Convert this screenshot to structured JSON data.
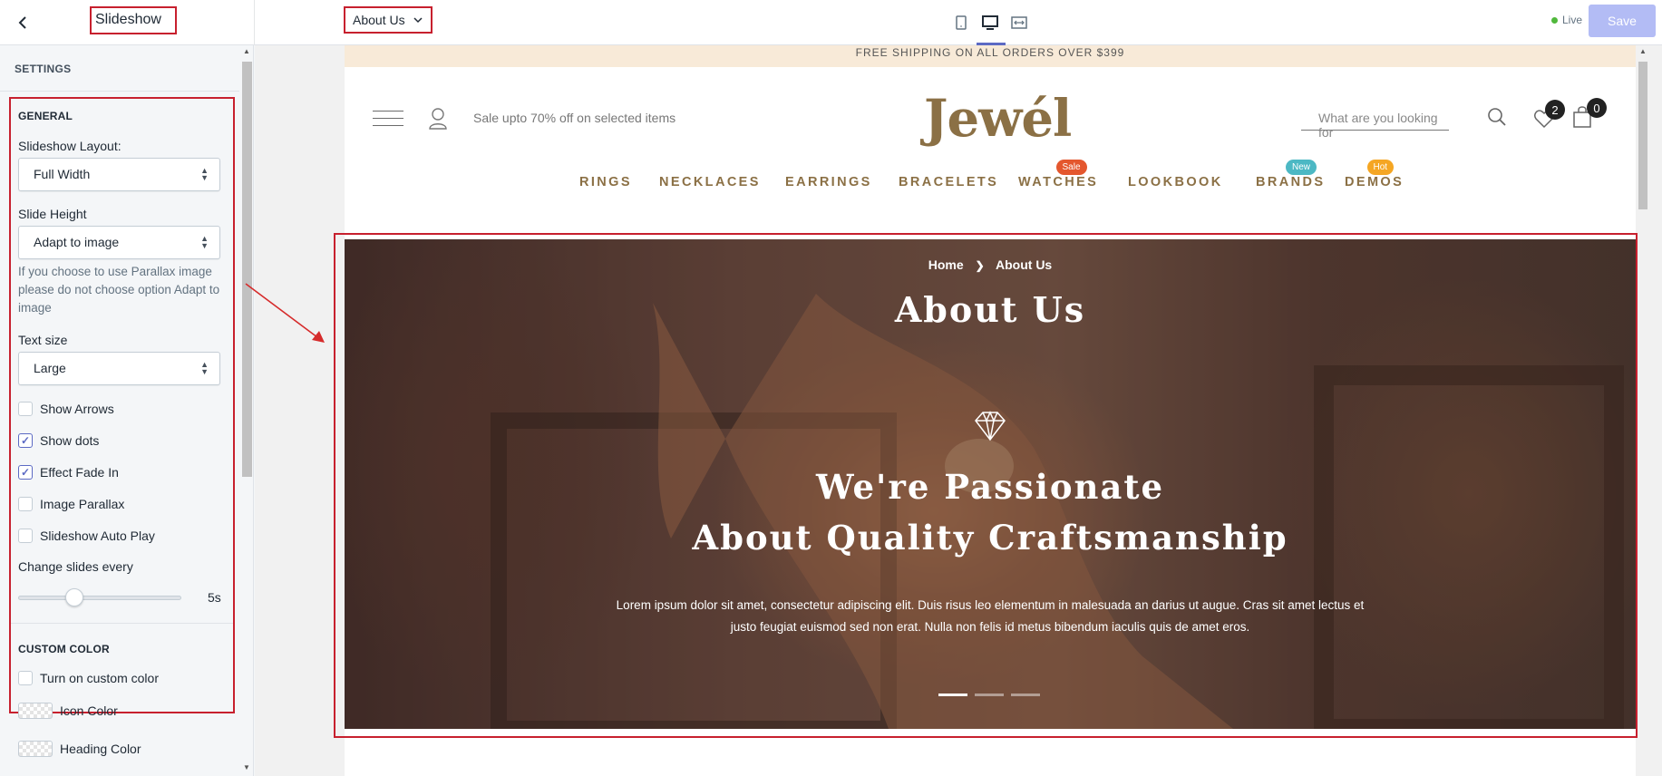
{
  "topbar": {
    "section_title": "Slideshow",
    "page_select": "About Us",
    "live_label": "Live",
    "save_label": "Save",
    "devices": [
      "mobile-icon",
      "desktop-icon",
      "fullscreen-icon"
    ]
  },
  "sidebar": {
    "settings_heading": "SETTINGS",
    "general_heading": "GENERAL",
    "layout_label": "Slideshow Layout:",
    "layout_value": "Full Width",
    "height_label": "Slide Height",
    "height_value": "Adapt to image",
    "height_help": "If you choose to use Parallax image please do not choose option Adapt to image",
    "text_size_label": "Text size",
    "text_size_value": "Large",
    "checkboxes": [
      {
        "label": "Show Arrows",
        "checked": false
      },
      {
        "label": "Show dots",
        "checked": true
      },
      {
        "label": "Effect Fade In",
        "checked": true
      },
      {
        "label": "Image Parallax",
        "checked": false
      },
      {
        "label": "Slideshow Auto Play",
        "checked": false
      }
    ],
    "change_slides_label": "Change slides every",
    "change_slides_value": "5s",
    "change_slides_level": 0.3,
    "custom_color_heading": "CUSTOM COLOR",
    "custom_color_toggle": "Turn on custom color",
    "icon_color_label": "Icon Color",
    "heading_color_label": "Heading Color"
  },
  "store": {
    "shipping_banner": "FREE SHIPPING ON ALL ORDERS OVER $399",
    "promo_text": "Sale upto 70% off on selected items",
    "logo": "Jewél",
    "search_placeholder": "What are you looking for",
    "wishlist_count": "2",
    "cart_count": "0",
    "nav": [
      {
        "label": "RINGS",
        "tag": ""
      },
      {
        "label": "NECKLACES",
        "tag": ""
      },
      {
        "label": "EARRINGS",
        "tag": ""
      },
      {
        "label": "BRACELETS",
        "tag": ""
      },
      {
        "label": "WATCHES",
        "tag": "Sale"
      },
      {
        "label": "LOOKBOOK",
        "tag": ""
      },
      {
        "label": "BRANDS",
        "tag": "New"
      },
      {
        "label": "DEMOS",
        "tag": "Hot"
      }
    ],
    "tag_colors": {
      "Sale": "#e4572e",
      "New": "#4cb8c4",
      "Hot": "#f5a623"
    },
    "hero": {
      "breadcrumb_home": "Home",
      "breadcrumb_current": "About Us",
      "title": "About Us",
      "heading_line1": "We're Passionate",
      "heading_line2": "About Quality Craftsmanship",
      "body": "Lorem ipsum dolor sit amet, consectetur adipiscing elit. Duis risus leo elementum in malesuada an darius ut augue. Cras sit amet lectus et justo feugiat euismod sed non erat. Nulla non felis id metus bibendum iaculis quis de amet eros.",
      "slide_count": 3,
      "active_slide": 1
    }
  }
}
